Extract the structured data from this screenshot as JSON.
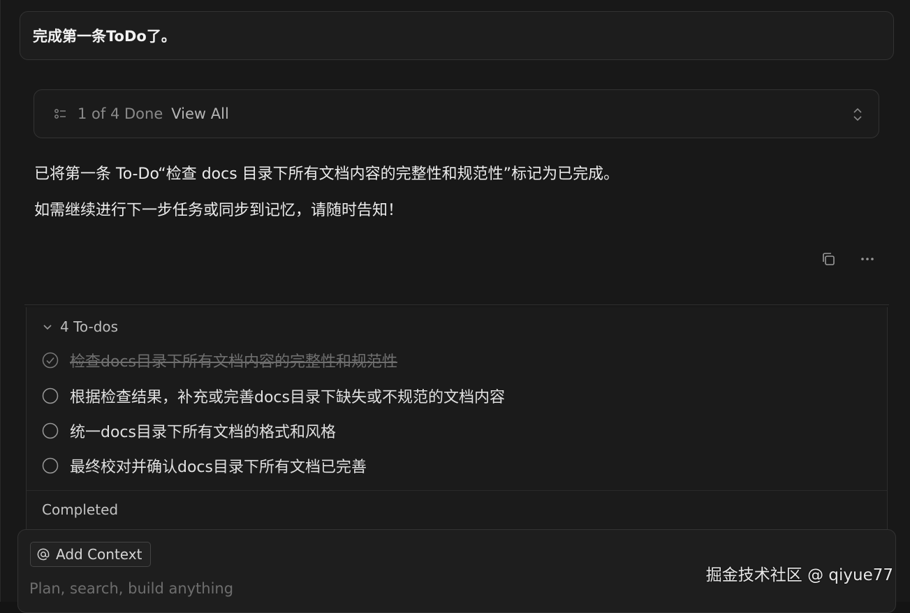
{
  "user_message": "完成第一条ToDo了。",
  "progress": {
    "done_text": "1 of 4 Done",
    "view_all_label": "View All",
    "list_icon": "list-check-icon",
    "sort_icon": "chevron-up-down-icon"
  },
  "assistant": {
    "line1": "已将第一条 To-Do“检查 docs 目录下所有文档内容的完整性和规范性”标记为已完成。",
    "line2": "如需继续进行下一步任务或同步到记忆，请随时告知！",
    "copy_icon": "copy-icon",
    "more_icon": "more-horizontal-icon"
  },
  "todos": {
    "header": "4 To-dos",
    "items": [
      {
        "label": "检查docs目录下所有文档内容的完整性和规范性",
        "done": true
      },
      {
        "label": "根据检查结果，补充或完善docs目录下缺失或不规范的文档内容",
        "done": false
      },
      {
        "label": "统一docs目录下所有文档的格式和风格",
        "done": false
      },
      {
        "label": "最终校对并确认docs目录下所有文档已完善",
        "done": false
      }
    ],
    "completed_label": "Completed"
  },
  "composer": {
    "add_context_label": "Add Context",
    "placeholder": "Plan, search, build anything"
  },
  "watermark": "掘金技术社区 @ qiyue77"
}
